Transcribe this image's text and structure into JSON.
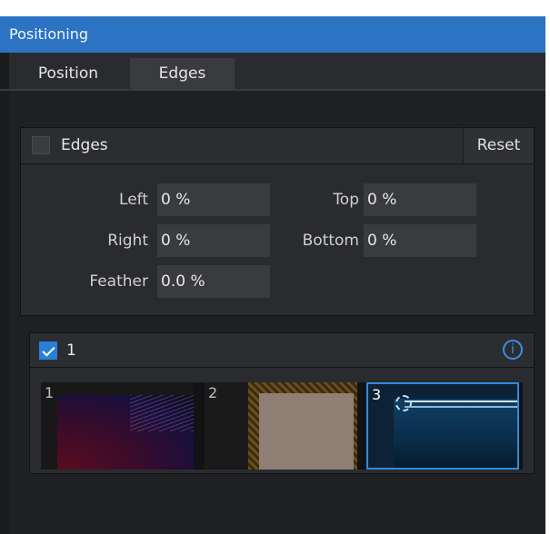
{
  "window": {
    "title": "Positioning"
  },
  "tabs": [
    {
      "label": "Position"
    },
    {
      "label": "Edges"
    }
  ],
  "edges_panel": {
    "enabled_label": "Edges",
    "enabled": false,
    "reset_label": "Reset",
    "fields": {
      "left": {
        "label": "Left",
        "value": "0 %"
      },
      "right": {
        "label": "Right",
        "value": "0 %"
      },
      "feather": {
        "label": "Feather",
        "value": "0.0 %"
      },
      "top": {
        "label": "Top",
        "value": "0 %"
      },
      "bottom": {
        "label": "Bottom",
        "value": "0 %"
      }
    }
  },
  "layer_panel": {
    "enabled": true,
    "label": "1",
    "info_icon": "info-icon",
    "thumbnails": [
      {
        "number": "1",
        "selected": false
      },
      {
        "number": "2",
        "selected": false
      },
      {
        "number": "3",
        "selected": true
      }
    ]
  },
  "colors": {
    "title_bar": "#2c73c4",
    "accent": "#2a7fd9",
    "panel": "#2a2b2e",
    "background": "#1b1c1e"
  }
}
